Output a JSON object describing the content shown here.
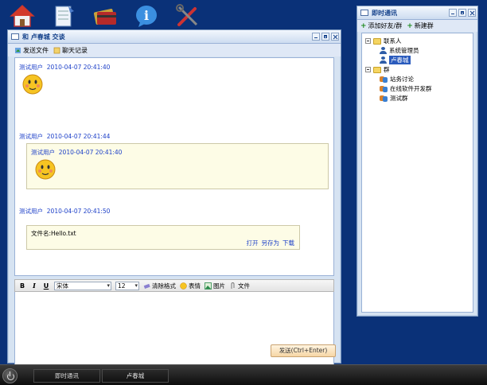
{
  "desktop_icons": [
    "home-icon",
    "notepad-icon",
    "cards-icon",
    "info-icon",
    "tools-icon"
  ],
  "chat": {
    "title": "和 卢春城 交谈",
    "toolbar": {
      "send_file": "发送文件",
      "chat_log": "聊天记录"
    },
    "messages": [
      {
        "user": "测试用户",
        "time": "2010-04-07 20:41:40"
      },
      {
        "user": "测试用户",
        "time": "2010-04-07 20:41:44"
      },
      {
        "user": "测试用户",
        "time": "2010-04-07 20:41:40"
      },
      {
        "user": "测试用户",
        "time": "2010-04-07 20:41:50"
      }
    ],
    "file": {
      "name_text": "文件名:Hello.txt",
      "open": "打开",
      "save_as": "另存为",
      "download": "下载"
    },
    "format": {
      "bold": "B",
      "italic": "I",
      "underline": "U",
      "font": "宋体",
      "size": "12",
      "clear": "清除格式",
      "emoji": "表情",
      "image": "图片",
      "file": "文件"
    },
    "send_label": "发送(Ctrl+Enter)"
  },
  "contacts": {
    "title": "即时通讯",
    "add_friend": "添加好友/群",
    "new_group": "新建群",
    "tree": {
      "contacts_folder": "联系人",
      "contacts": [
        "系统管理员",
        "卢春城"
      ],
      "groups_folder": "群",
      "groups": [
        "站务讨论",
        "在线软件开发群",
        "测试群"
      ]
    }
  },
  "taskbar": {
    "tasks": [
      "即时通讯",
      "卢春城"
    ]
  },
  "colors": {
    "desktop": "#0a3178",
    "link": "#1c3fc8",
    "selected": "#2a5bbd"
  }
}
